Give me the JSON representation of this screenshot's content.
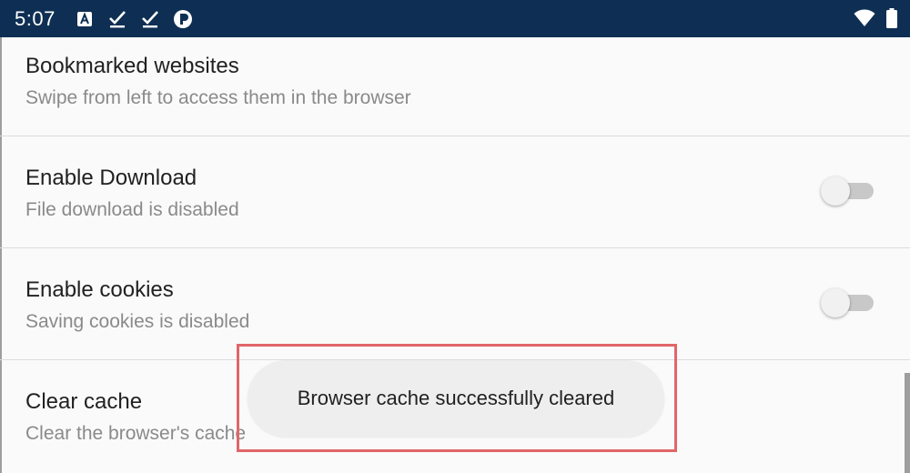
{
  "status_bar": {
    "time": "5:07",
    "left_icons": [
      "a-icon",
      "check-icon",
      "check-icon",
      "app-icon"
    ],
    "right_icons": [
      "wifi-icon",
      "battery-icon"
    ],
    "background_color": "#0e2f53"
  },
  "settings": {
    "items": [
      {
        "title": "Bookmarked websites",
        "summary": "Swipe from left to access them in the browser"
      },
      {
        "title": "Enable Download",
        "summary": "File download is disabled",
        "toggle": "off"
      },
      {
        "title": "Enable cookies",
        "summary": "Saving cookies is disabled",
        "toggle": "off"
      },
      {
        "title": "Clear cache",
        "summary": "Clear the browser's cache"
      }
    ]
  },
  "toast": {
    "message": "Browser cache successfully cleared",
    "highlight_color": "#e06669"
  }
}
